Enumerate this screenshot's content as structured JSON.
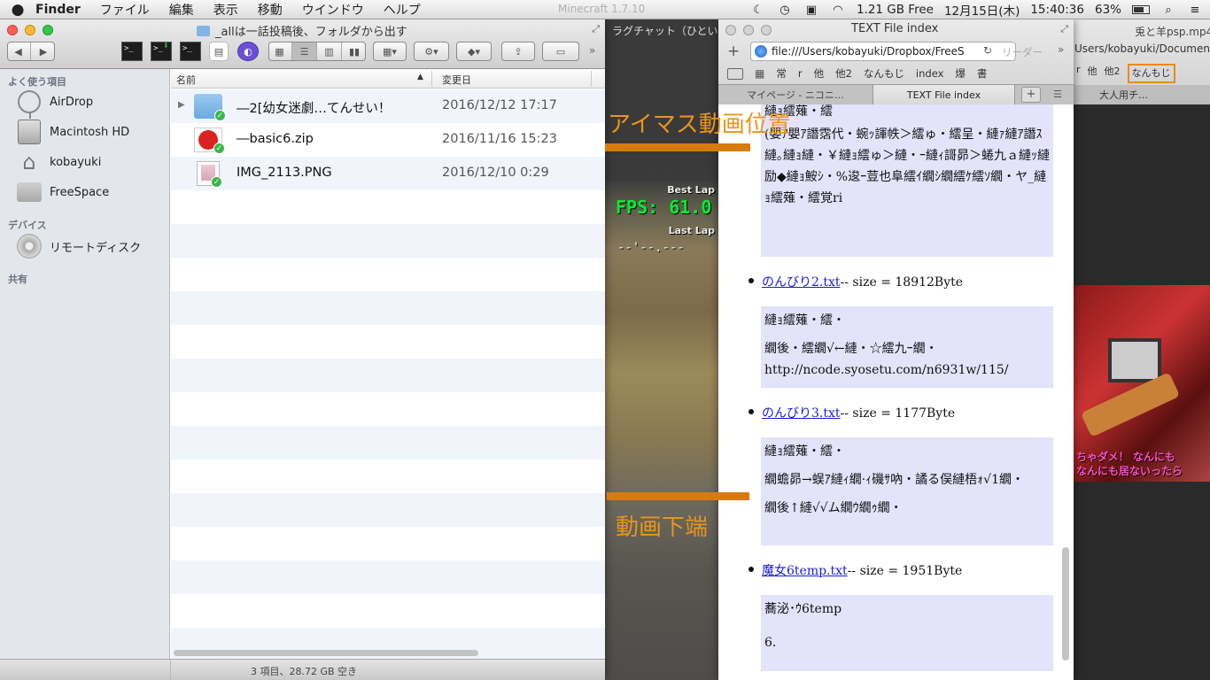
{
  "menubar": {
    "apple": "",
    "app": "Finder",
    "menus": [
      "ファイル",
      "編集",
      "表示",
      "移動",
      "ウインドウ",
      "ヘルプ"
    ],
    "background_title": "Minecraft 1.7.10",
    "free_space": "1.21 GB Free",
    "date": "12月15日(木)",
    "time": "15:40:36",
    "battery": "63%"
  },
  "finder": {
    "title": "_allは一話投稿後、フォルダから出す",
    "columns": {
      "name": "名前",
      "modified": "変更日"
    },
    "sidebar": {
      "favorites_header": "よく使う項目",
      "favorites": [
        "AirDrop",
        "Macintosh HD",
        "kobayuki",
        "FreeSpace"
      ],
      "devices_header": "デバイス",
      "devices": [
        "リモートディスク"
      ],
      "shared_header": "共有"
    },
    "files": [
      {
        "name": "―2[幼女迷劇…てんせい！",
        "date": "2016/12/12 17:17",
        "type": "folder"
      },
      {
        "name": "―basic6.zip",
        "date": "2016/11/16 15:23",
        "type": "zip"
      },
      {
        "name": "IMG_2113.PNG",
        "date": "2016/12/10 0:29",
        "type": "png"
      }
    ],
    "status": "3 項目、28.72 GB 空き"
  },
  "background_video": {
    "chat_title": "ラグチャット（ひとい",
    "best_lap": "Best Lap",
    "fps": "FPS: 61.0",
    "last_lap": "Last Lap",
    "dashes": "--'--.---"
  },
  "browser": {
    "title": "TEXT File index",
    "url": "file:///Users/kobayuki/Dropbox/FreeS",
    "reader": "リーダー",
    "bookmarks": [
      "常",
      "r",
      "他",
      "他2",
      "なんもじ",
      "index",
      "爆",
      "書"
    ],
    "tabs": [
      "マイページ - ニコニ…",
      "TEXT File index"
    ],
    "partial_top": "縺ｮ繧薙・繧",
    "first_box": "(嬰ｱ嬰ｱ譖霑代・蜿ｯ諢帙＞繧ゅ・繧呈・縺ｧ縺ｱ譖ｽ縺｡縺ｮ縺・￥縺ｮ繧ゅ＞縺・ｰ縺ｨ謌昴＞蜷九ａ縺ｯ縺励◆縺ｮ鮟ｼ・%逡ｰ荳也阜繧ｲ繝ｼ繝繧ｹ繧ｿ繝・ヤ_縺ｮ繧薙・繧覚ri",
    "items": [
      {
        "link": "のんびり2.txt",
        "size": " -- size = 18912Byte",
        "lines": [
          "縺ｮ繧薙・繧・",
          "繝後・繧繝√←縺・☆繧九ｰ繝・http://ncode.syosetu.com/n6931w/115/"
        ]
      },
      {
        "link": "のんびり3.txt",
        "size": " -- size = 1177Byte",
        "lines": [
          "縺ｮ繧薙・繧・",
          "繝蟾昴→蜈ｱ縺ｨ繝·ｨ磯ｻ吶・譎る俣縺梧ｫ√1繝・",
          "繝後↑縺√√ム繝ｳ繝ｩ繝・"
        ]
      },
      {
        "link": "魔女6temp.txt",
        "size": " -- size = 1951Byte",
        "lines": [
          "蕎泌･ｳ6temp",
          "6."
        ]
      }
    ]
  },
  "right_window": {
    "title": "兎と羊psp.mp4",
    "url": "Users/kobayuki/Documents",
    "bookmarks": [
      "r",
      "他",
      "他2",
      "なんもじ"
    ],
    "tab": "大人用チ…",
    "caption1": "ちゃダメ！ なんにも",
    "caption2": "なんにも居ないったら"
  },
  "annotations": {
    "video_position": "アイマス動画位置",
    "video_bottom": "動画下端",
    "color": "#d97a10"
  }
}
